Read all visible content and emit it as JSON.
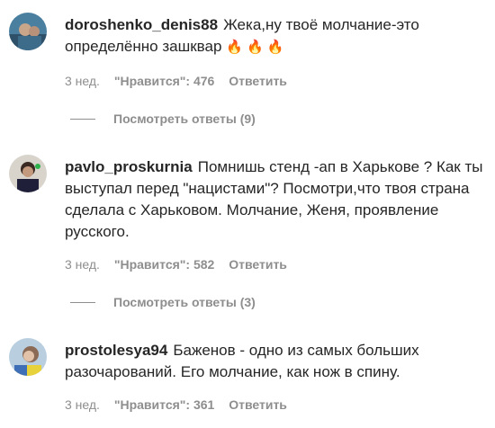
{
  "comments": [
    {
      "username": "doroshenko_denis88",
      "text": "Жека,ну твоё молчание-это определённо зашквар",
      "emoji": "🔥 🔥 🔥",
      "time": "3 нед.",
      "likes": "\"Нравится\": 476",
      "reply": "Ответить",
      "view_replies": "Посмотреть ответы (9)"
    },
    {
      "username": "pavlo_proskurnia",
      "text": "Помнишь стенд -ап в Харькове ? Как ты выступал перед \"нацистами\"? Посмотри,что твоя страна сделала с Харьковом. Молчание, Женя, проявление русского.",
      "time": "3 нед.",
      "likes": "\"Нравится\": 582",
      "reply": "Ответить",
      "view_replies": "Посмотреть ответы (3)"
    },
    {
      "username": "prostolesya94",
      "text": "Баженов - одно из самых больших разочарований. Его молчание, как нож в спину.",
      "time": "3 нед.",
      "likes": "\"Нравится\": 361",
      "reply": "Ответить"
    }
  ]
}
